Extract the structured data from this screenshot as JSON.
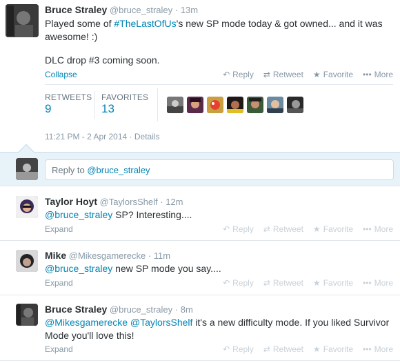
{
  "main_tweet": {
    "author_name": "Bruce Straley",
    "author_handle": "@bruce_straley",
    "time_ago": "13m",
    "text_before_tag": "Played some of ",
    "hashtag": "#TheLastOfUs",
    "text_after_tag": "'s new SP mode today & got owned...  and it was awesome! :)",
    "text_line2": "DLC drop #3 coming soon.",
    "collapse_label": "Collapse",
    "retweets_label": "RETWEETS",
    "retweets_count": "9",
    "favorites_label": "FAVORITES",
    "favorites_count": "13",
    "timestamp": "11:21 PM - 2 Apr 2014",
    "details_label": "Details"
  },
  "actions": {
    "reply": "Reply",
    "retweet": "Retweet",
    "favorite": "Favorite",
    "more": "More"
  },
  "reply_box": {
    "prefix": "Reply to ",
    "handle": "@bruce_straley"
  },
  "replies": [
    {
      "author_name": "Taylor Hoyt",
      "author_handle": "@TaylorsShelf",
      "time_ago": "12m",
      "mention": "@bruce_straley",
      "text": " SP? Interesting....",
      "expand_label": "Expand"
    },
    {
      "author_name": "Mike",
      "author_handle": "@Mikesgamerecke",
      "time_ago": "11m",
      "mention": "@bruce_straley",
      "text": " new SP mode you say....",
      "expand_label": "Expand"
    },
    {
      "author_name": "Bruce Straley",
      "author_handle": "@bruce_straley",
      "time_ago": "8m",
      "mention": "@Mikesgamerecke",
      "mention2": "@TaylorsShelf",
      "text": " it's a new difficulty mode. If you liked Survivor Mode you'll love this!",
      "expand_label": "Expand"
    }
  ],
  "icons": {
    "reply": "reply-arrow-icon",
    "retweet": "retweet-icon",
    "favorite": "star-icon",
    "more": "more-dots-icon"
  }
}
